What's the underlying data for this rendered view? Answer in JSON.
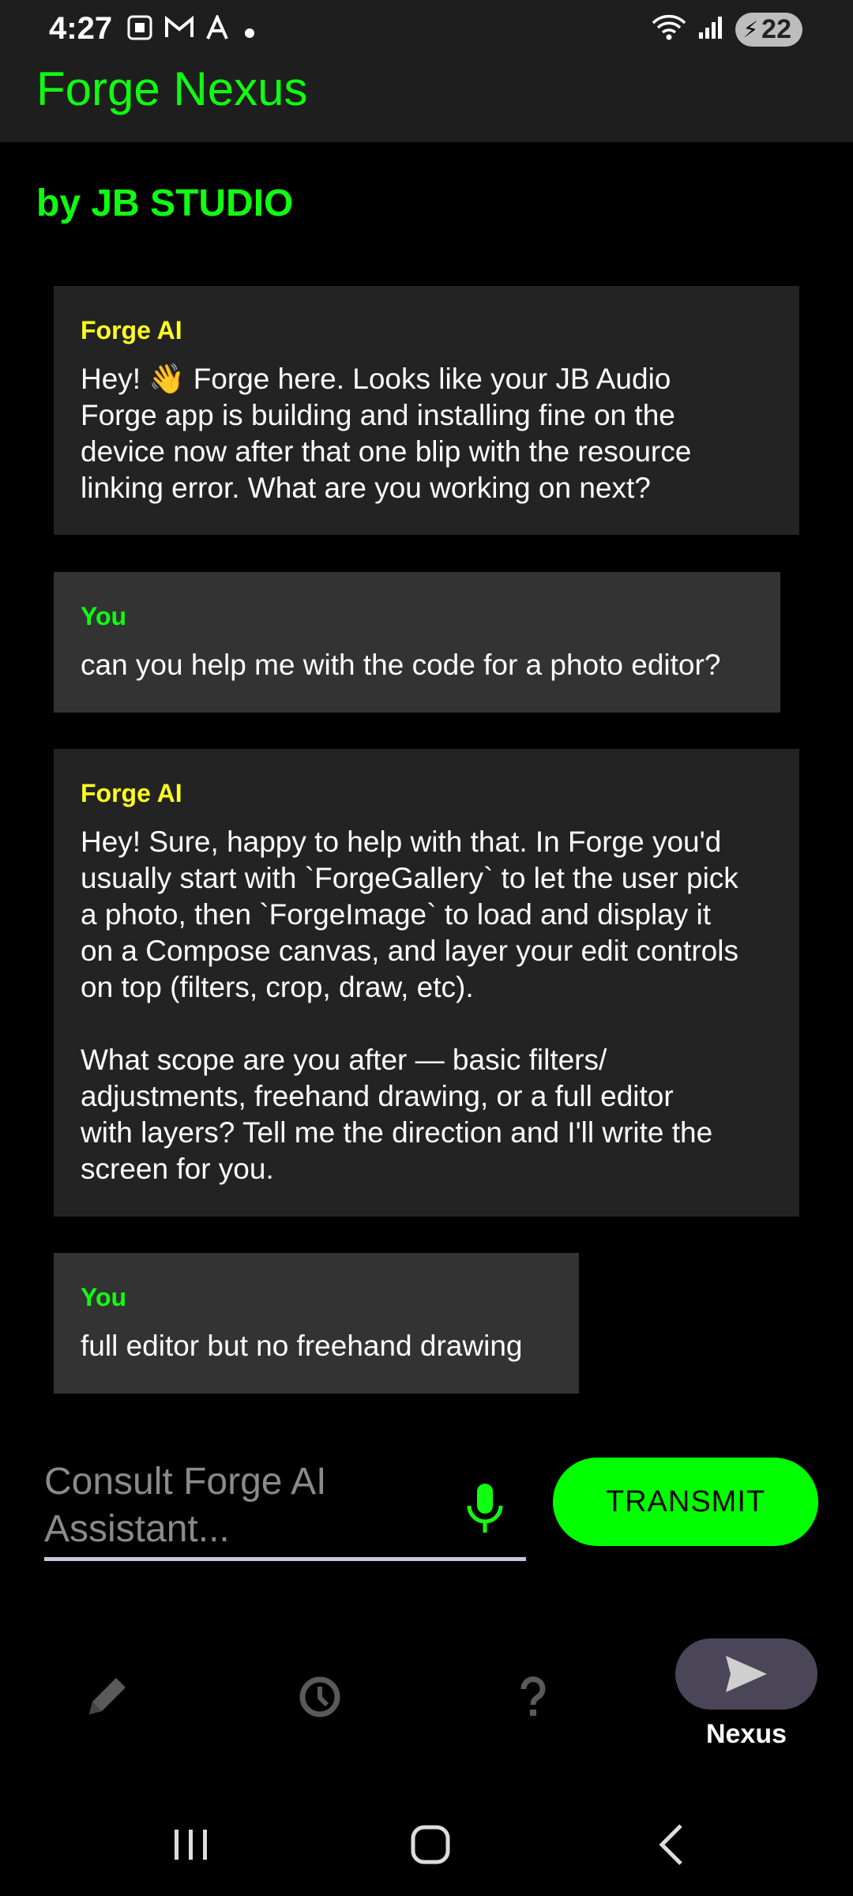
{
  "status": {
    "time": "4:27",
    "battery": "22",
    "left_icons": [
      "screenshot-icon",
      "gmail-icon",
      "font-icon",
      "dot-icon"
    ]
  },
  "app": {
    "title": "Forge Nexus",
    "subtitle": "by JB STUDIO"
  },
  "messages": [
    {
      "sender": "Forge AI",
      "role": "ai",
      "text": "Hey! 👋 Forge here. Looks like your JB Audio\nForge app is building and installing fine on the\ndevice now after that one blip with the resource\nlinking error. What are you working on next?"
    },
    {
      "sender": "You",
      "role": "user",
      "text": "can you help me with the code for a photo editor?"
    },
    {
      "sender": "Forge AI",
      "role": "ai",
      "text": "Hey! Sure, happy to help with that. In Forge you'd\nusually start with `ForgeGallery` to let the user pick\na photo, then `ForgeImage` to load and display it\non a Compose canvas, and layer your edit controls\non top (filters, crop, draw, etc).\n\nWhat scope are you after — basic filters/\nadjustments, freehand drawing, or a full editor\nwith layers? Tell me the direction and I'll write the\nscreen for you."
    },
    {
      "sender": "You",
      "role": "user",
      "text": "full editor but no freehand drawing"
    }
  ],
  "input": {
    "placeholder": "Consult Forge AI Assistant..."
  },
  "transmit_label": "TRANSMIT",
  "nav": {
    "items": [
      "pencil-icon",
      "history-icon",
      "help-icon",
      "send-icon"
    ],
    "active_label": "Nexus"
  },
  "colors": {
    "accent_green": "#10ff10",
    "ai_sender_yellow": "#ffff20",
    "button_green": "#00ff00"
  }
}
